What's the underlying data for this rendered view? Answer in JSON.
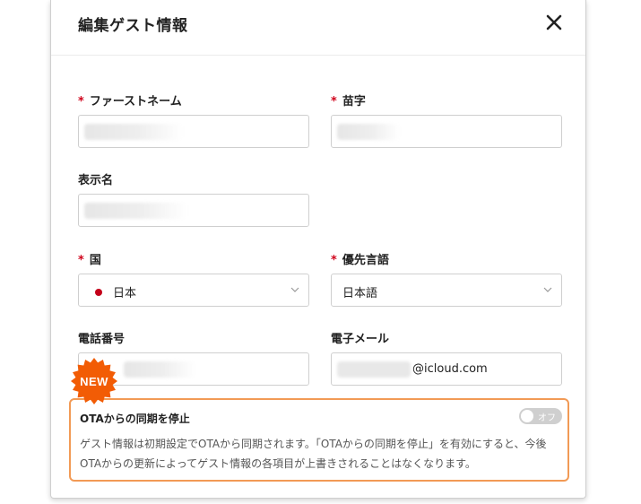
{
  "dialog": {
    "title": "編集ゲスト情報",
    "close_icon": "close-icon"
  },
  "form": {
    "required_mark": "*",
    "first_name": {
      "label": "ファーストネーム",
      "value": ""
    },
    "last_name": {
      "label": "苗字",
      "value": ""
    },
    "display_name": {
      "label": "表示名",
      "value": ""
    },
    "country": {
      "label": "国",
      "value": "日本",
      "flag_color": "#c4001a"
    },
    "language": {
      "label": "優先言語",
      "value": "日本語"
    },
    "phone": {
      "label": "電話番号",
      "value": ""
    },
    "email": {
      "label": "電子メール",
      "value_suffix": "@icloud.com"
    }
  },
  "badge": {
    "text": "NEW",
    "color": "#f25c05"
  },
  "ota": {
    "title": "OTAからの同期を停止",
    "toggle_label": "オフ",
    "toggle_state": "off",
    "description": "ゲスト情報は初期設定でOTAから同期されます。「OTAからの同期を停止」を有効にすると、今後OTAからの更新によってゲスト情報の各項目が上書きされることはなくなります。",
    "border_color": "#f29a55"
  }
}
